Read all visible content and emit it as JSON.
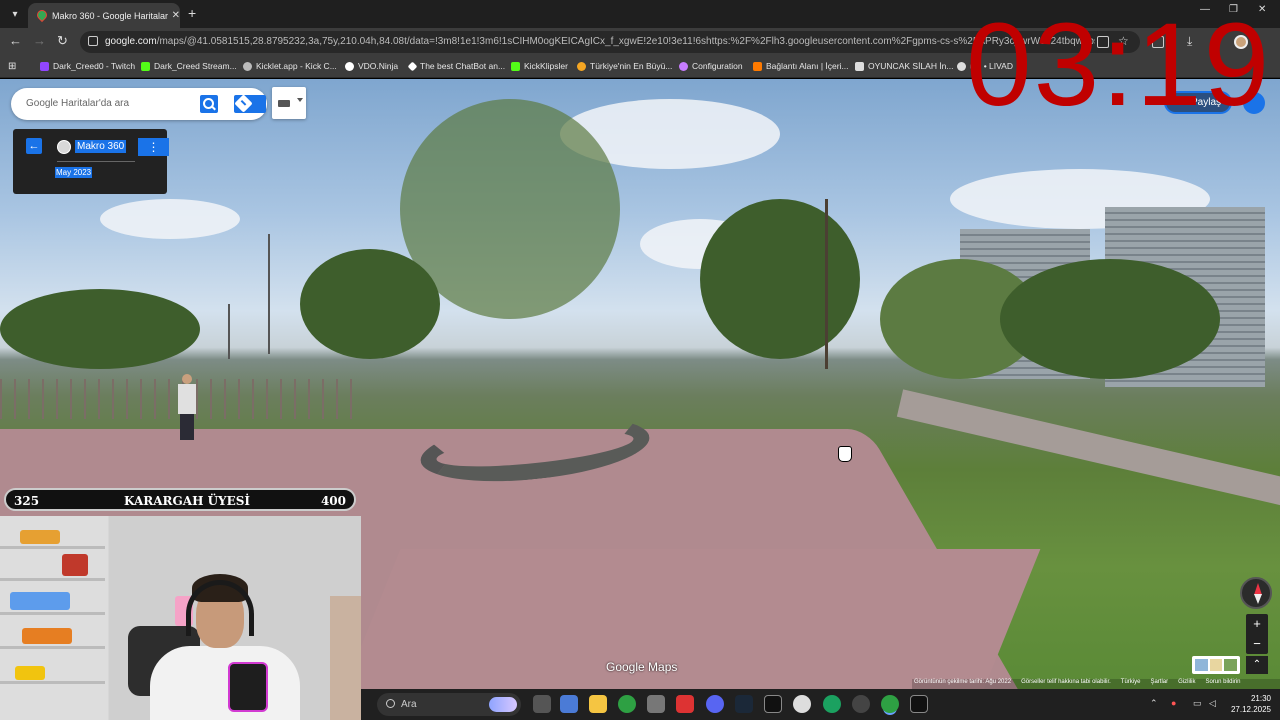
{
  "browser": {
    "tab_title": "Makro 360 - Google Haritalar",
    "url_domain": "google.com",
    "url_path": "/maps/@41.0581515,28.8795232,3a,75y,210.04h,84.08t/data=!3m8!1e1!3m6!1sCIHM0ogKEICAgICx_f_xgwE!2e10!3e11!6shttps:%2F%2Flh3.googleusercontent.com%2Fgpms-cs-s%2FAPRy3c_wrW9z24tbqwobsz...Mio7...KkpW...",
    "bookmarks": [
      {
        "label": "Dark_Creed0 - Twitch",
        "color": "#9146ff"
      },
      {
        "label": "Dark_Creed Stream...",
        "color": "#9146ff"
      },
      {
        "label": "Kicklet.app - Kick C...",
        "color": "#bbbbbb"
      },
      {
        "label": "VDO.Ninja",
        "color": "#ffffff"
      },
      {
        "label": "The best ChatBot an...",
        "color": "#ffffff"
      },
      {
        "label": "KickKlipsler",
        "color": "#53fc18"
      },
      {
        "label": "Türkiye'nin En Büyü...",
        "color": "#f5a623"
      },
      {
        "label": "Configuration",
        "color": "#c77dff"
      },
      {
        "label": "Bağlantı Alanı | İçeri...",
        "color": "#ff7a00"
      },
      {
        "label": "OYUNCAK SİLAH İn...",
        "color": "#dddddd"
      },
      {
        "label": "uel • LIVAD",
        "color": "#dddddd"
      }
    ]
  },
  "maps": {
    "search_placeholder": "Google Haritalar'da ara",
    "place_name": "Makro 360",
    "place_date": "May 2023",
    "share_label": "Paylaş",
    "logo": "Google Maps",
    "attribution": [
      "Görüntünün çekilme tarihi: Ağu 2022",
      "Görseller telif hakkına tabi olabilir.",
      "Türkiye",
      "Şartlar",
      "Gizlilik",
      "Sorun bildirin"
    ],
    "zoom_in": "+",
    "zoom_out": "−"
  },
  "overlay": {
    "timer": "03:19",
    "xp_left": "325",
    "xp_title": "KARARGAH ÜYESİ",
    "xp_right": "400",
    "xp_progress": 0.0
  },
  "taskbar": {
    "search_label": "Ara",
    "time": "21:30",
    "date": "27.12.2025",
    "apps": [
      "task-view",
      "store",
      "file-explorer",
      "chrome",
      "app-cube",
      "app-red",
      "discord",
      "steam",
      "epic-games",
      "chatgpt",
      "app-green-circle",
      "obs",
      "chrome-active",
      "epic-games-2"
    ]
  },
  "colors": {
    "accent": "#1a73e8",
    "timer": "#c00000"
  }
}
